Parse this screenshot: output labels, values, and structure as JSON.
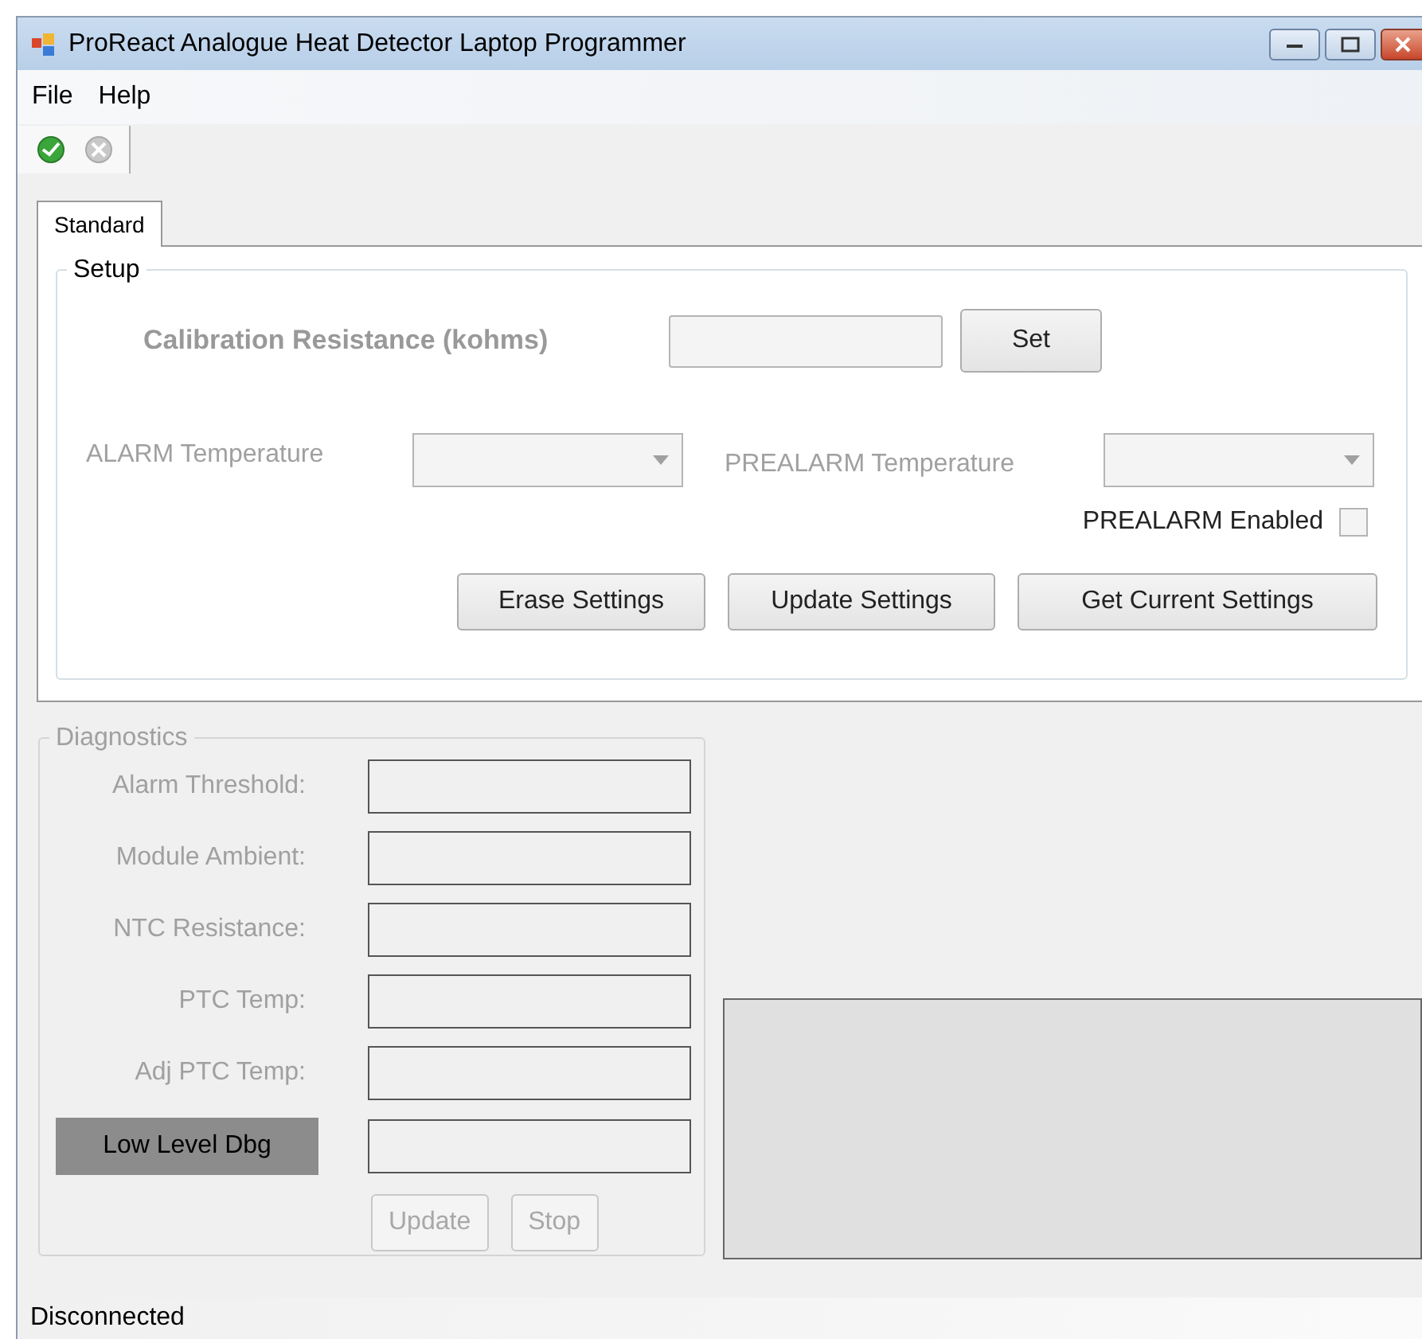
{
  "window": {
    "title": "ProReact Analogue Heat Detector Laptop Programmer"
  },
  "menu": [
    "File",
    "Help"
  ],
  "toolbar": [
    {
      "kind": "connect",
      "disabled": false
    },
    {
      "kind": "disconnect",
      "disabled": true
    }
  ],
  "tabs": [
    {
      "label": "Standard",
      "selected": true
    }
  ],
  "setup": {
    "title": "Setup",
    "calibration_label": "Calibration Resistance (kohms)",
    "set_button": "Set",
    "alarm_label": "ALARM Temperature",
    "prealarm_label": "PREALARM Temperature",
    "prealarm_enabled": {
      "label": "PREALARM Enabled",
      "checked": false
    },
    "buttons": [
      "Erase Settings",
      "Update Settings",
      "Get Current Settings"
    ]
  },
  "diagnostics": {
    "title": "Diagnostics",
    "rows": [
      {
        "label": "Alarm Threshold:",
        "kind": "label"
      },
      {
        "label": "Module Ambient:",
        "kind": "label"
      },
      {
        "label": "NTC Resistance:",
        "kind": "label"
      },
      {
        "label": "PTC Temp:",
        "kind": "label"
      },
      {
        "label": "Adj PTC Temp:",
        "kind": "label"
      },
      {
        "label": "Low Level Dbg",
        "kind": "highlight"
      }
    ],
    "buttons": [
      {
        "label": "Update",
        "disabled": true
      },
      {
        "label": "Stop",
        "disabled": true
      }
    ]
  },
  "status_bar": "Disconnected"
}
